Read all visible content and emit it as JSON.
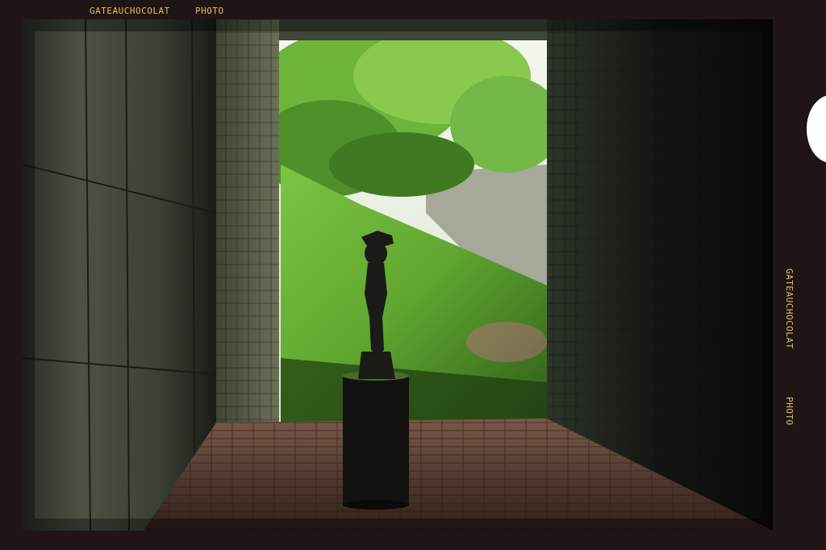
{
  "film": {
    "brand": "GATEAUCHOCOLAT",
    "type": "PHOTO"
  },
  "colors": {
    "frame": "#1f1516",
    "label": "#e0c15a",
    "foliage": "#6fb83a",
    "tile_floor": "#6b4a40"
  },
  "scene": {
    "subjects": [
      "statue-silhouette",
      "pedestal",
      "tunnel-walls",
      "grassy-slope",
      "trees",
      "tile-floor"
    ]
  }
}
